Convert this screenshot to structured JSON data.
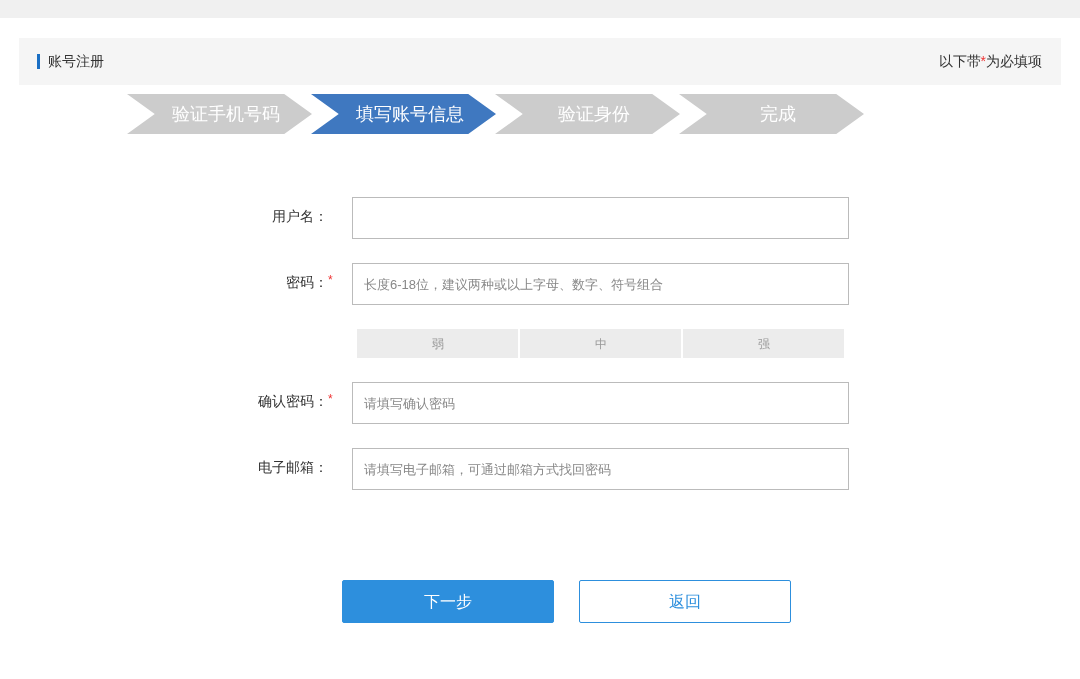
{
  "header": {
    "title": "账号注册",
    "note": {
      "before": "以下带",
      "mark": "*",
      "after": "为必填项"
    }
  },
  "steps": [
    {
      "label": "验证手机号码",
      "selected": false
    },
    {
      "label": "填写账号信息",
      "selected": true
    },
    {
      "label": "验证身份",
      "selected": false
    },
    {
      "label": "完成",
      "selected": false
    }
  ],
  "fields": [
    {
      "label": "用户名："
    },
    {
      "label": "密码：",
      "required_mark": "*",
      "placeholder": "长度6-18位，建议两种或以上字母、数字、符号组合",
      "strength": [
        {
          "label": "弱",
          "lit": false
        },
        {
          "label": "中",
          "lit": false
        },
        {
          "label": "强",
          "lit": false
        }
      ]
    },
    {
      "label": "确认密码：",
      "required_mark": "*",
      "placeholder": "请填写确认密码"
    },
    {
      "label": "电子邮箱：",
      "placeholder": "请填写电子邮箱，可通过邮箱方式找回密码"
    }
  ],
  "buttons": [
    {
      "label": "下一步",
      "kind": "primary"
    },
    {
      "label": "返回",
      "kind": "secondary"
    }
  ]
}
